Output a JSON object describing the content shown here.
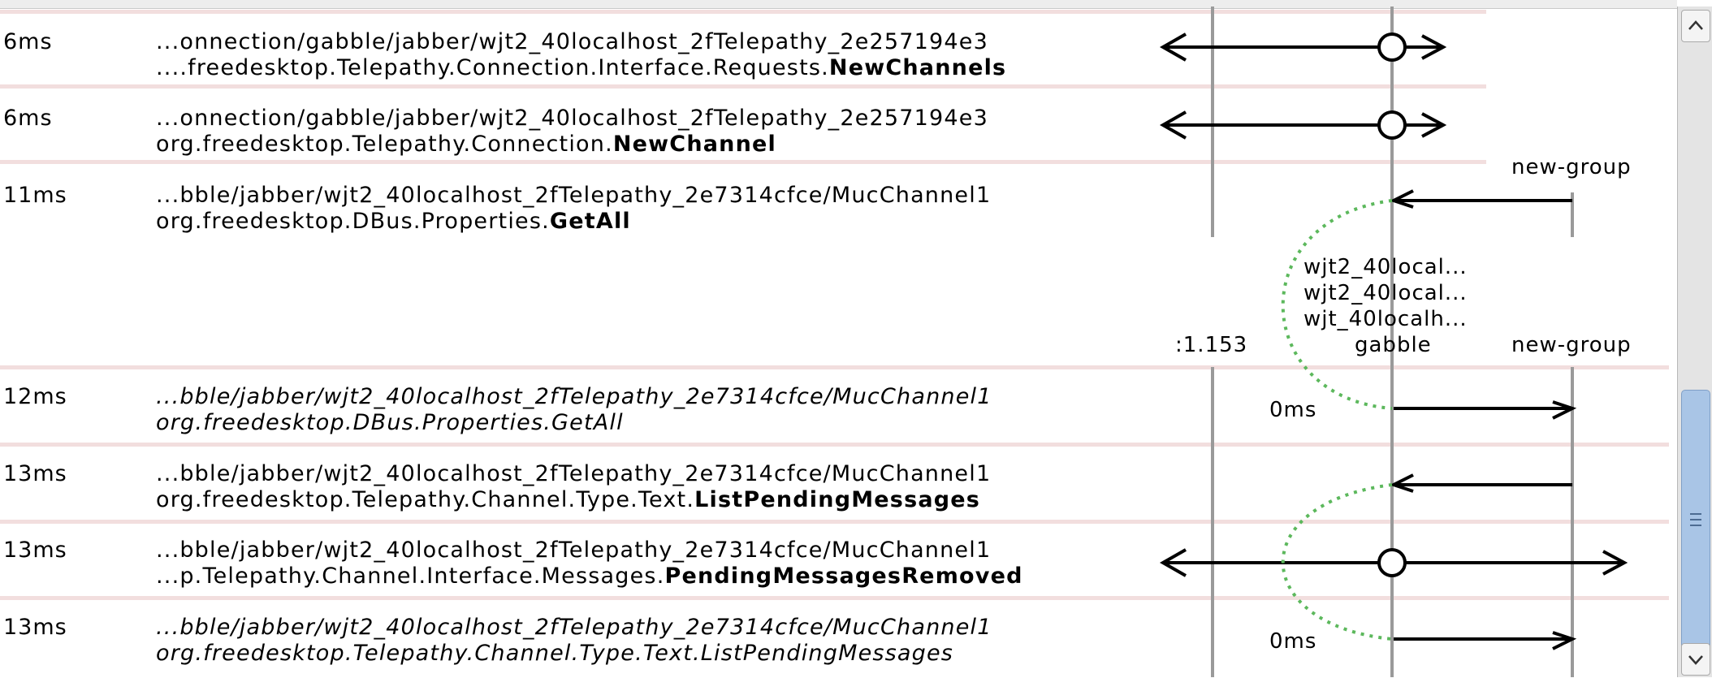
{
  "rows": [
    {
      "time": "6ms",
      "path": "...onnection/gabble/jabber/wjt2_40localhost_2fTelepathy_2e257194e3",
      "iface": "....freedesktop.Telepathy.Connection.Interface.Requests.",
      "member": "NewChannels",
      "italic": false
    },
    {
      "time": "6ms",
      "path": "...onnection/gabble/jabber/wjt2_40localhost_2fTelepathy_2e257194e3",
      "iface": "org.freedesktop.Telepathy.Connection.",
      "member": "NewChannel",
      "italic": false
    },
    {
      "time": "11ms",
      "path": "...bble/jabber/wjt2_40localhost_2fTelepathy_2e7314cfce/MucChannel1",
      "iface": "org.freedesktop.DBus.Properties.",
      "member": "GetAll",
      "italic": false
    },
    {
      "time": "12ms",
      "path": "...bble/jabber/wjt2_40localhost_2fTelepathy_2e7314cfce/MucChannel1",
      "iface": "org.freedesktop.DBus.Properties.GetAll",
      "member": "",
      "italic": true
    },
    {
      "time": "13ms",
      "path": "...bble/jabber/wjt2_40localhost_2fTelepathy_2e7314cfce/MucChannel1",
      "iface": "org.freedesktop.Telepathy.Channel.Type.Text.",
      "member": "ListPendingMessages",
      "italic": false
    },
    {
      "time": "13ms",
      "path": "...bble/jabber/wjt2_40localhost_2fTelepathy_2e7314cfce/MucChannel1",
      "iface": "...p.Telepathy.Channel.Interface.Messages.",
      "member": "PendingMessagesRemoved",
      "italic": false
    },
    {
      "time": "13ms",
      "path": "...bble/jabber/wjt2_40localhost_2fTelepathy_2e7314cfce/MucChannel1",
      "iface": "org.freedesktop.Telepathy.Channel.Type.Text.ListPendingMessages",
      "member": "",
      "italic": true
    }
  ],
  "lanes": {
    "header_lines": [
      "wjt2_40local...",
      "wjt2_40local...",
      "wjt_40localh...",
      "gabble"
    ],
    "bus_label": ":1.153",
    "new_group_top": "new-group",
    "new_group_bottom": "new-group"
  },
  "durations": {
    "reply1": "0ms",
    "reply2": "0ms"
  },
  "colors": {
    "separator": "#f2dede",
    "dotted": "#5cb85c",
    "scroll_thumb": "#a9c5e6"
  },
  "icons": {
    "scroll_up": "chevron-up-icon",
    "scroll_down": "chevron-down-icon",
    "grip": "grip-icon"
  }
}
